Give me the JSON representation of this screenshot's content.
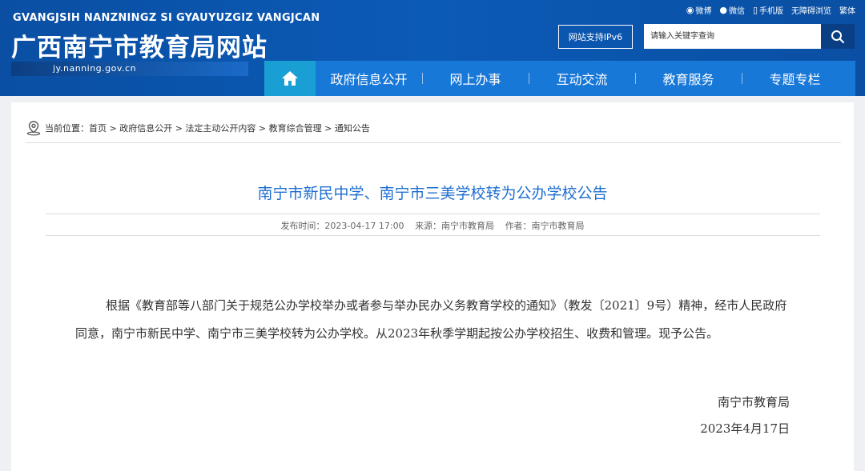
{
  "header": {
    "pinyin": "GVANGJSIH NANZNINGZ SI GYAUYUZGIZ VANGJCAN",
    "title": "广西南宁市教育局网站",
    "url": "jy.nanning.gov.cn",
    "top_links": [
      {
        "icon": "weibo-icon",
        "glyph": "◉",
        "label": "微博"
      },
      {
        "icon": "wechat-icon",
        "glyph": "●",
        "label": "微信"
      },
      {
        "icon": "mobile-icon",
        "glyph": "▯",
        "label": "手机版"
      },
      {
        "icon": "",
        "glyph": "",
        "label": "无障碍浏览"
      },
      {
        "icon": "",
        "glyph": "",
        "label": "繁体"
      }
    ],
    "ipv6_label": "网站支持IPv6",
    "search_placeholder": "请输入关键字查询"
  },
  "nav": {
    "items": [
      "政府信息公开",
      "网上办事",
      "互动交流",
      "教育服务",
      "专题专栏"
    ]
  },
  "breadcrumb": {
    "label": "当前位置：首页 > 政府信息公开 > 法定主动公开内容 > 教育综合管理 > 通知公告"
  },
  "article": {
    "title": "南宁市新民中学、南宁市三美学校转为公办学校公告",
    "publish_time": "发布时间：2023-04-17 17:00",
    "source": "来源：南宁市教育局",
    "author": "作者：南宁市教育局",
    "body": "根据《教育部等八部门关于规范公办学校举办或者参与举办民办义务教育学校的通知》（教发〔2021〕9号）精神，经市人民政府同意，南宁市新民中学、南宁市三美学校转为公办学校。从2023年秋季学期起按公办学校招生、收费和管理。现予公告。",
    "signature_org": "南宁市教育局",
    "signature_date": "2023年4月17日"
  },
  "colors": {
    "header_blue": "#0b56ad",
    "nav_blue": "#1878d8",
    "home_teal": "#1a9fd4",
    "title_blue": "#1f6fd1"
  }
}
